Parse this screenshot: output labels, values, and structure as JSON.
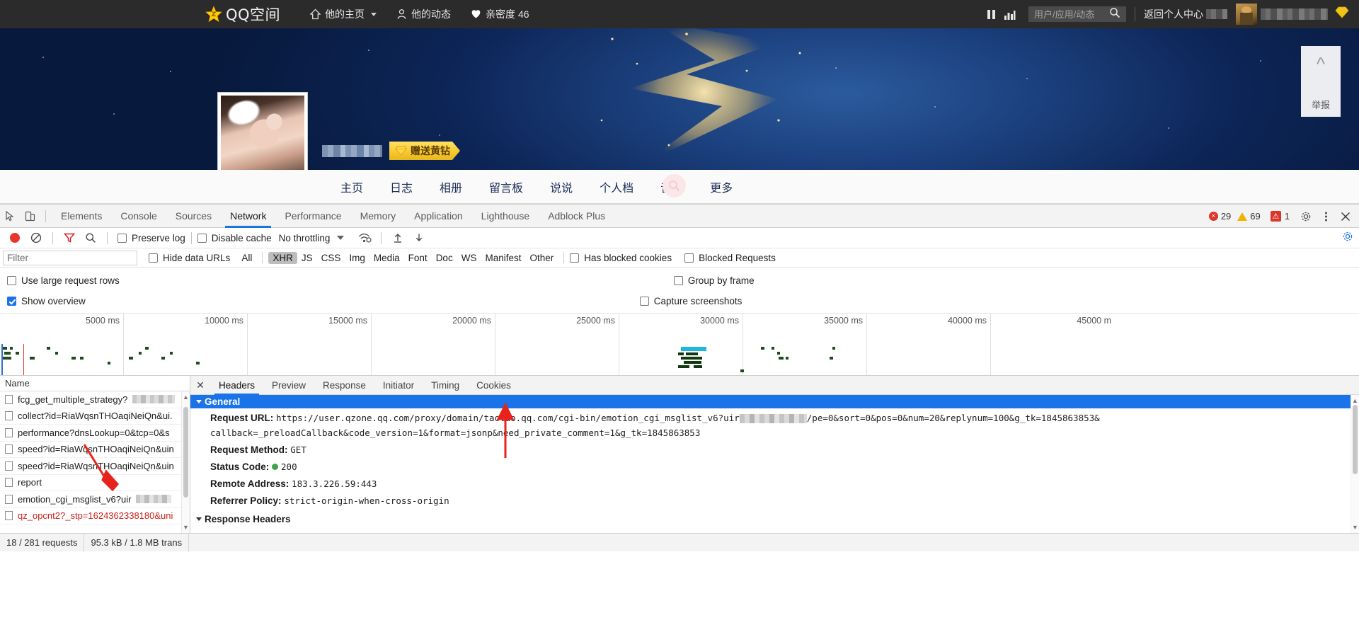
{
  "qzone": {
    "logo_text": "QQ空间",
    "nav": [
      {
        "label": "他的主页",
        "icon": "home-icon",
        "has_caret": true
      },
      {
        "label": "他的动态",
        "icon": "user-icon",
        "has_caret": false
      },
      {
        "label": "亲密度 46",
        "icon": "heart-icon",
        "has_caret": false
      }
    ],
    "search_placeholder": "用户/应用/动态",
    "back_link": "返回个人中心",
    "gift_button": "赠送黄钻",
    "report_label": "举报",
    "tabs": [
      "主页",
      "日志",
      "相册",
      "留言板",
      "说说",
      "个人档",
      "音乐",
      "更多"
    ]
  },
  "devtools": {
    "panels": [
      "Elements",
      "Console",
      "Sources",
      "Network",
      "Performance",
      "Memory",
      "Application",
      "Lighthouse",
      "Adblock Plus"
    ],
    "active_panel": "Network",
    "counts": {
      "errors": "29",
      "warnings": "69",
      "issues": "1"
    },
    "toolbar": {
      "preserve_log": "Preserve log",
      "preserve_log_checked": false,
      "disable_cache": "Disable cache",
      "disable_cache_checked": false,
      "throttling": "No throttling"
    },
    "filter": {
      "placeholder": "Filter",
      "value": "",
      "hide_data_urls": "Hide data URLs",
      "hide_data_urls_checked": false,
      "types": [
        "All",
        "XHR",
        "JS",
        "CSS",
        "Img",
        "Media",
        "Font",
        "Doc",
        "WS",
        "Manifest",
        "Other"
      ],
      "active_type": "XHR",
      "has_blocked_cookies": "Has blocked cookies",
      "has_blocked_cookies_checked": false,
      "blocked_requests": "Blocked Requests",
      "blocked_requests_checked": false
    },
    "options": {
      "use_large_request_rows": "Use large request rows",
      "use_large_request_rows_checked": false,
      "show_overview": "Show overview",
      "show_overview_checked": true,
      "group_by_frame": "Group by frame",
      "group_by_frame_checked": false,
      "capture_screenshots": "Capture screenshots",
      "capture_screenshots_checked": false
    },
    "overview": {
      "ticks": [
        "5000 ms",
        "10000 ms",
        "15000 ms",
        "20000 ms",
        "25000 ms",
        "30000 ms",
        "35000 ms",
        "40000 ms",
        "45000 m"
      ]
    },
    "request_list": {
      "column_header": "Name",
      "rows": [
        {
          "name": "fcg_get_multiple_strategy?",
          "blurred": true,
          "error": false
        },
        {
          "name": "collect?id=RiaWqsnTHOaqiNeiQn&ui.",
          "blurred": false,
          "error": false
        },
        {
          "name": "performance?dnsLookup=0&tcp=0&s",
          "blurred": false,
          "error": false
        },
        {
          "name": "speed?id=RiaWqsnTHOaqiNeiQn&uin",
          "blurred": false,
          "error": false
        },
        {
          "name": "speed?id=RiaWqsnTHOaqiNeiQn&uin",
          "blurred": false,
          "error": false
        },
        {
          "name": "report",
          "blurred": false,
          "error": false
        },
        {
          "name": "emotion_cgi_msglist_v6?uir",
          "blurred": true,
          "error": false
        },
        {
          "name": "qz_opcnt2?_stp=1624362338180&uni",
          "blurred": false,
          "error": true
        }
      ]
    },
    "detail": {
      "tabs": [
        "Headers",
        "Preview",
        "Response",
        "Initiator",
        "Timing",
        "Cookies"
      ],
      "active_tab": "Headers",
      "section_general": "General",
      "fields": [
        {
          "key": "Request URL:",
          "value_prefix": "https://user.qzone.qq.com/proxy/domain/taotao.qq.com/cgi-bin/emotion_cgi_msglist_v6?uir",
          "value_suffix": "/pe=0&sort=0&pos=0&num=20&replynum=100&g_tk=1845863853&",
          "value_line2": "callback=_preloadCallback&code_version=1&format=jsonp&need_private_comment=1&g_tk=1845863853",
          "blurred": true
        },
        {
          "key": "Request Method:",
          "value": "GET"
        },
        {
          "key": "Status Code:",
          "value": "200",
          "status_ok": true
        },
        {
          "key": "Remote Address:",
          "value": "183.3.226.59:443"
        },
        {
          "key": "Referrer Policy:",
          "value": "strict-origin-when-cross-origin"
        }
      ],
      "section_response_headers": "Response Headers"
    },
    "statusbar": {
      "requests": "18 / 281 requests",
      "transferred": "95.3 kB / 1.8 MB trans"
    }
  },
  "colors": {
    "accent_blue": "#1a73e8",
    "error_red": "#dc3628",
    "warning_yellow": "#f0b400",
    "qzone_gold": "#f7c931",
    "status_green": "#3ea34a"
  }
}
